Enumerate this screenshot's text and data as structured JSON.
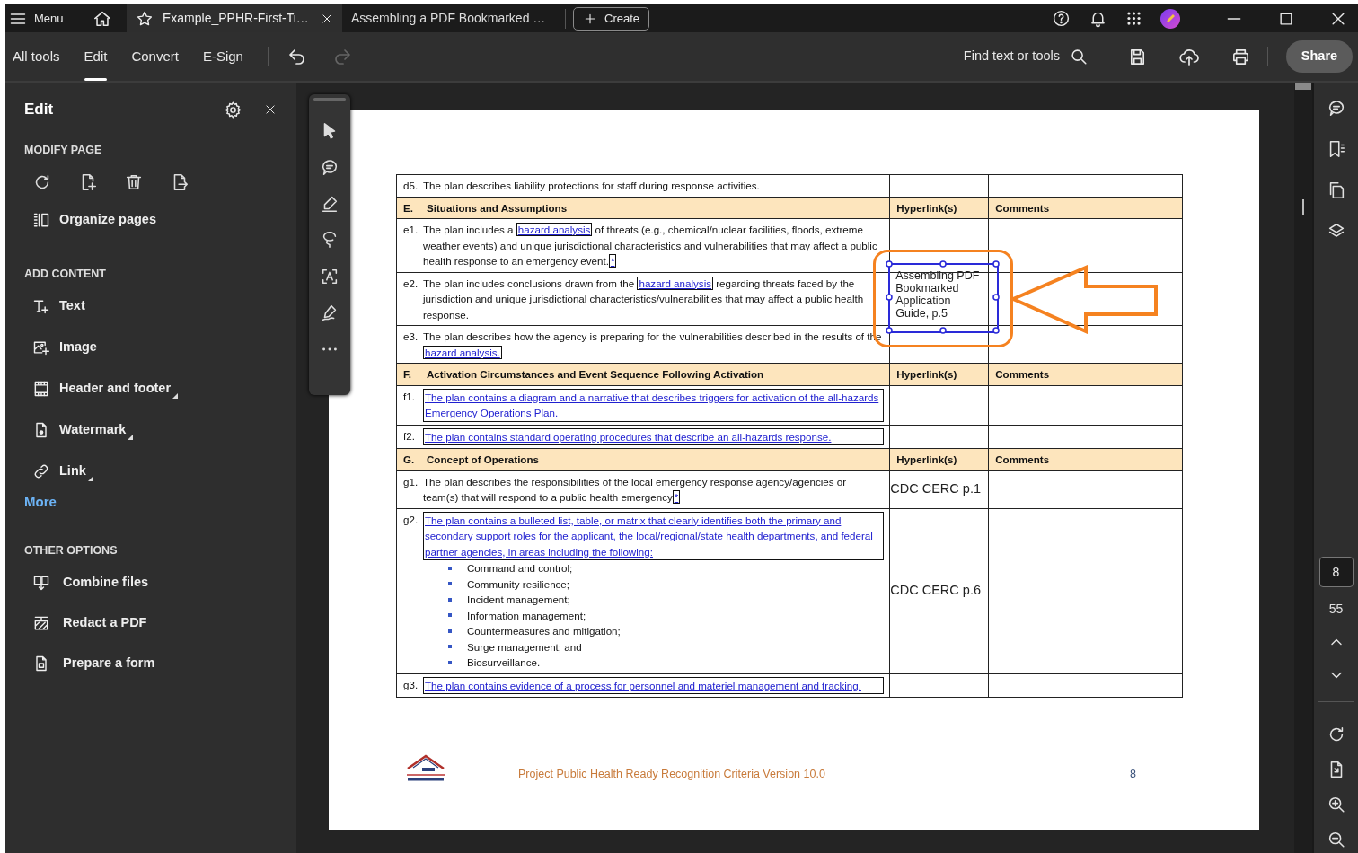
{
  "title_bar": {
    "menu_label": "Menu",
    "tabs": [
      {
        "label": "Example_PPHR-First-Ti…",
        "selected": true
      },
      {
        "label": "Assembling a PDF Bookmarked …",
        "selected": false
      }
    ],
    "create_label": "Create"
  },
  "toolbar": {
    "tools": [
      {
        "label": "All tools",
        "selected": false
      },
      {
        "label": "Edit",
        "selected": true
      },
      {
        "label": "Convert",
        "selected": false
      },
      {
        "label": "E-Sign",
        "selected": false
      }
    ],
    "history": [
      {
        "kind": "undo",
        "disabled": false
      },
      {
        "kind": "redo",
        "disabled": true
      }
    ],
    "search_label": "Find text or tools",
    "share_label": "Share"
  },
  "edit_panel": {
    "title": "Edit",
    "sections": [
      {
        "kind": "modify",
        "heading": "MODIFY PAGE",
        "items": [
          {
            "label": "Organize pages",
            "has_submenu": false
          }
        ]
      },
      {
        "kind": "add",
        "heading": "ADD CONTENT",
        "items": [
          {
            "label": "Text",
            "has_submenu": false
          },
          {
            "label": "Image",
            "has_submenu": false
          },
          {
            "label": "Header and footer",
            "has_submenu": true
          },
          {
            "label": "Watermark",
            "has_submenu": true
          },
          {
            "label": "Link",
            "has_submenu": true
          }
        ],
        "more_label": "More"
      },
      {
        "kind": "other",
        "heading": "OTHER OPTIONS",
        "items": [
          {
            "label": "Combine files",
            "has_submenu": false
          },
          {
            "label": "Redact a PDF",
            "has_submenu": false
          },
          {
            "label": "Prepare a form",
            "has_submenu": false
          }
        ]
      }
    ]
  },
  "document": {
    "rows": [
      {
        "kind": "item",
        "label": "d5.",
        "segments": [
          {
            "text": "The plan describes liability protections for staff during response activities.",
            "link": false
          }
        ]
      },
      {
        "kind": "section",
        "label": "E.",
        "title": "Situations and Assumptions",
        "hyperlink_heading": "Hyperlink(s)",
        "comments_heading": "Comments"
      },
      {
        "kind": "item",
        "label": "e1.",
        "segments": [
          {
            "text": "The plan includes a ",
            "link": false
          },
          {
            "text": "hazard analysis",
            "link": true
          },
          {
            "text": " of threats (e.g., chemical/nuclear facilities, floods, extreme weather events) and unique jurisdictional characteristics and vulnerabilities that may affect a public health response to an emergency event.",
            "link": false
          },
          {
            "text": "*",
            "link": true
          }
        ]
      },
      {
        "kind": "item",
        "label": "e2.",
        "segments": [
          {
            "text": "The plan includes conclusions drawn from the ",
            "link": false
          },
          {
            "text": "hazard analysis",
            "link": true
          },
          {
            "text": " regarding threats faced by the jurisdiction and unique jurisdictional characteristics/vulnerabilities that may affect a public health response.",
            "link": false
          }
        ],
        "annotation": {
          "text": "Assembling PDF Bookmarked Application Guide, p.5",
          "selected": true
        }
      },
      {
        "kind": "item",
        "label": "e3.",
        "segments": [
          {
            "text": "The plan describes how the agency is preparing for the vulnerabilities described in the results of the ",
            "link": false
          },
          {
            "text": "hazard analysis.",
            "link": true
          }
        ]
      },
      {
        "kind": "section",
        "label": "F.",
        "title": "Activation Circumstances and Event Sequence Following Activation",
        "hyperlink_heading": "Hyperlink(s)",
        "comments_heading": "Comments"
      },
      {
        "kind": "item",
        "label": "f1.",
        "segments": [
          {
            "text": "The plan contains a diagram and a narrative that describes triggers for activation of the all-hazards Emergency Operations Plan.",
            "link": true
          }
        ]
      },
      {
        "kind": "item",
        "label": "f2.",
        "segments": [
          {
            "text": "The plan contains standard operating procedures that describe an all-hazards response.",
            "link": true
          }
        ]
      },
      {
        "kind": "section",
        "label": "G.",
        "title": "Concept of Operations",
        "hyperlink_heading": "Hyperlink(s)",
        "comments_heading": "Comments"
      },
      {
        "kind": "item",
        "label": "g1.",
        "segments": [
          {
            "text": "The plan describes the responsibilities of the local emergency response agency/agencies or team(s) that will respond to a public health emergency",
            "link": false
          },
          {
            "text": "*",
            "link": true
          }
        ],
        "hyperlink": "CDC CERC p.1"
      },
      {
        "kind": "item",
        "label": "g2.",
        "segments": [
          {
            "text": "The plan contains a bulleted list, table, or matrix that clearly identifies both the primary and secondary support roles for the applicant, the local/regional/state health departments, and federal partner agencies, in areas including the following:",
            "link": true
          }
        ],
        "bullets": [
          "Command and control;",
          "Community resilience;",
          "Incident management;",
          "Information management;",
          "Countermeasures and mitigation;",
          "Surge management; and",
          "Biosurveillance."
        ],
        "hyperlink": "CDC CERC p.6"
      },
      {
        "kind": "item",
        "label": "g3.",
        "segments": [
          {
            "text": "The plan contains evidence of a process for personnel and materiel management and tracking.",
            "link": true
          }
        ]
      }
    ],
    "footer_text": "Project Public Health Ready Recognition Criteria Version 10.0",
    "page_number": "8"
  },
  "page_nav": {
    "current": "8",
    "total": "55"
  }
}
